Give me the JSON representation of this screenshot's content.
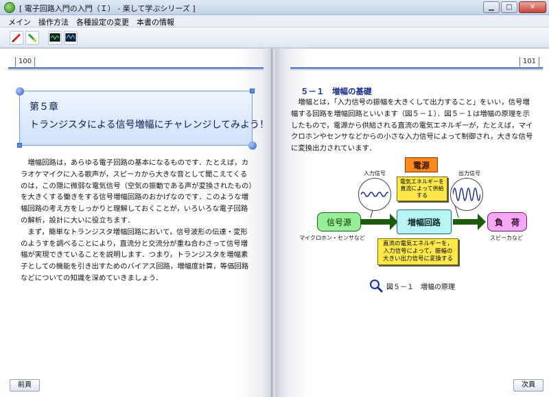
{
  "window": {
    "title": "[ 電子回路入門の入門（Ｉ） - 楽して学ぶシリーズ ]"
  },
  "menu": [
    "メイン",
    "操作方法",
    "各種設定の変更",
    "本書の情報"
  ],
  "toolbar": {
    "buttons": [
      "pen-tool-icon",
      "screwdriver-tool-icon",
      "oscilloscope-icon",
      "function-generator-icon"
    ]
  },
  "left_page": {
    "page_number": "100",
    "chapter_number": "第５章",
    "chapter_title": "トランジスタによる信号増幅にチャレンジしてみよう！",
    "paragraphs": [
      "増幅回路は，あらゆる電子回路の基本になるものです．たとえば，カラオケマイクに入る歌声が，スピーカから大きな音として聞こえてくるのは，この隠に微弱な電気信号（空気の振動である声が変換されたもの）を大きくする働きをする信号増幅回路のおかげなのです．このような増幅回路の考え方をしっかりと理解しておくことが，いろいろな電子回路の解析，設計に大いに役立ちます．",
      "まず，簡単なトランジスタ増幅回路において，信号波形の伝達・変形のようすを調べることにより，直流分と交流分が重ね合わさって信号増幅が実現できていることを説明します．つまり，トランジスタを増幅素子としての機能を引き出すためのバイアス回路，増幅度計算，等価回路などについての知識を深めていきましょう．"
    ],
    "prev_button": "前頁"
  },
  "right_page": {
    "page_number": "101",
    "section_heading": "５－１　増幅の基礎",
    "paragraph": "増幅とは，「入力信号の振幅を大きくして出力すること」をいい，信号増幅する回路を増幅回路といいます（図５－１）．図５－１は増幅の原理を示したもので，電源から供給される直流の電気エネルギーが，たとえば，マイクロホンやセンサなどからの小さな入力信号によって制御され，大きな信号に変換出力されています．",
    "next_button": "次頁",
    "diagram": {
      "power": "電源",
      "power_note": "電気エネルギーを直流によって供給する",
      "input_label": "入力信号",
      "output_label": "出力信号",
      "source": "信号源",
      "source_sub": "マイクロホン・センサなど",
      "amp": "増幅回路",
      "load": "負　荷",
      "load_sub": "スピーカなど",
      "amp_note": "直流の電気エネルギーを，入力信号によって，振幅の大きい出力信号に変換する"
    },
    "figure_caption": "図５－１　増幅の原理"
  }
}
